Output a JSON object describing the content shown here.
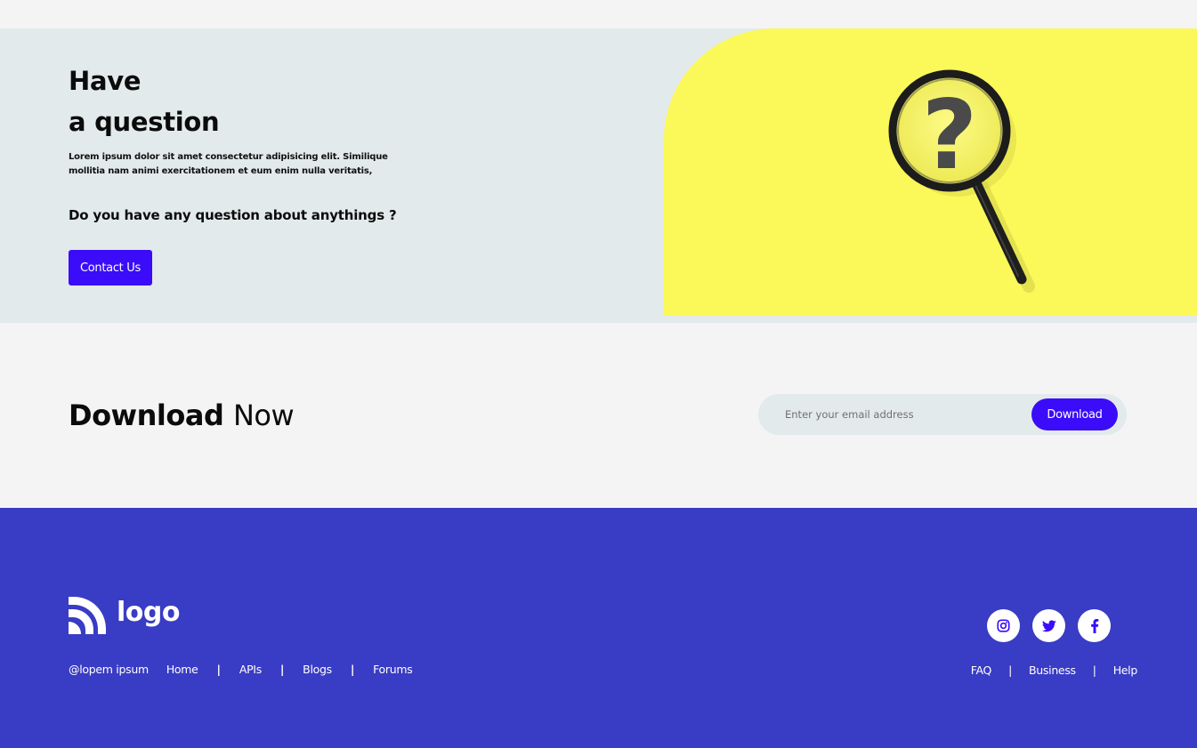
{
  "hero": {
    "title_line1": "Have",
    "title_line2": "a question",
    "description": "Lorem ipsum dolor sit amet consectetur adipisicing elit. Similique mollitia nam animi exercitationem et eum enim nulla veritatis,",
    "question": "Do you have any question about anythings ?",
    "contact_label": "Contact Us",
    "image_icon": "magnifying-glass-question-icon",
    "image_bg_color": "#fbf85a"
  },
  "download": {
    "title_bold": "Download",
    "title_light": "Now",
    "email_placeholder": "Enter your email address",
    "button_label": "Download"
  },
  "footer": {
    "logo_text": "logo",
    "logo_icon": "rss-feed-icon",
    "copyright": "@lopem ipsum",
    "links_left": [
      "Home",
      "APIs",
      "Blogs",
      "Forums"
    ],
    "links_right": [
      "FAQ",
      "Business",
      "Help"
    ],
    "socials": [
      "instagram-icon",
      "twitter-icon",
      "facebook-icon"
    ],
    "bg_color": "#393cc4"
  },
  "colors": {
    "accent": "#3a0cf9",
    "hero_bg": "#e3eaeb",
    "page_bg": "#f4f4f4"
  }
}
